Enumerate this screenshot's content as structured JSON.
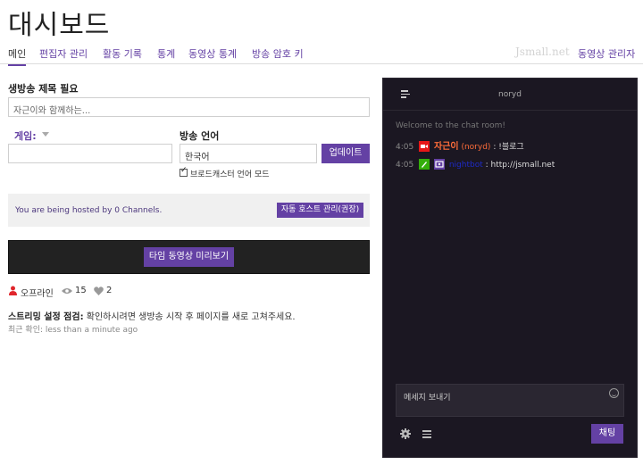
{
  "page": {
    "title": "대시보드"
  },
  "nav": {
    "tabs": [
      "메인",
      "편집자 관리",
      "활동 기록",
      "통계",
      "동영상 통계",
      "방송 암호 키"
    ],
    "brand": "Jsmall.net",
    "video_manager": "동영상 관리자"
  },
  "form": {
    "title_label": "생방송 제목 필요",
    "title_placeholder": "자근이와 함께하는...",
    "game_label": "게임:",
    "game_value": "",
    "language_label": "방송 언어",
    "language_value": "한국어",
    "update_button": "업데이트",
    "broadcaster_language_mode": "브로드캐스터 언어 모드",
    "broadcaster_language_checked": true
  },
  "hosting": {
    "text": "You are being hosted by 0 Channels.",
    "button": "자동 호스트 관리(권장)"
  },
  "preview": {
    "button": "타임 동영상 미리보기"
  },
  "stats": {
    "status": "오프라인",
    "views": "15",
    "followers": "2"
  },
  "stream_health": {
    "label": "스트리밍 설정 점검:",
    "message": "확인하시려면 생방송 시작 후 페이지를 새로 고쳐주세요.",
    "last_checked": "최근 확인: less than a minute ago"
  },
  "chat": {
    "room": "noryd",
    "welcome": "Welcome to the chat room!",
    "messages": [
      {
        "time": "4:05",
        "user": "자근이",
        "login": "(noryd)",
        "text": "!블로그"
      },
      {
        "time": "4:05",
        "user": "nightbot",
        "login": "",
        "text": "http://jsmall.net"
      }
    ],
    "input_placeholder": "메세지 보내기",
    "send_button": "채팅"
  },
  "colors": {
    "accent": "#6441a4",
    "chat_bg": "#1b1722",
    "broadcaster_badge": "#e71818",
    "mod_badge": "#34ae0a",
    "username_orange": "#ff6d3a"
  },
  "icons": [
    "menu-icon",
    "caret-down-icon",
    "user-offline-icon",
    "eye-icon",
    "heart-icon",
    "broadcaster-badge-icon",
    "moderator-badge-icon",
    "bot-badge-icon",
    "smiley-icon",
    "gear-icon",
    "list-icon"
  ]
}
